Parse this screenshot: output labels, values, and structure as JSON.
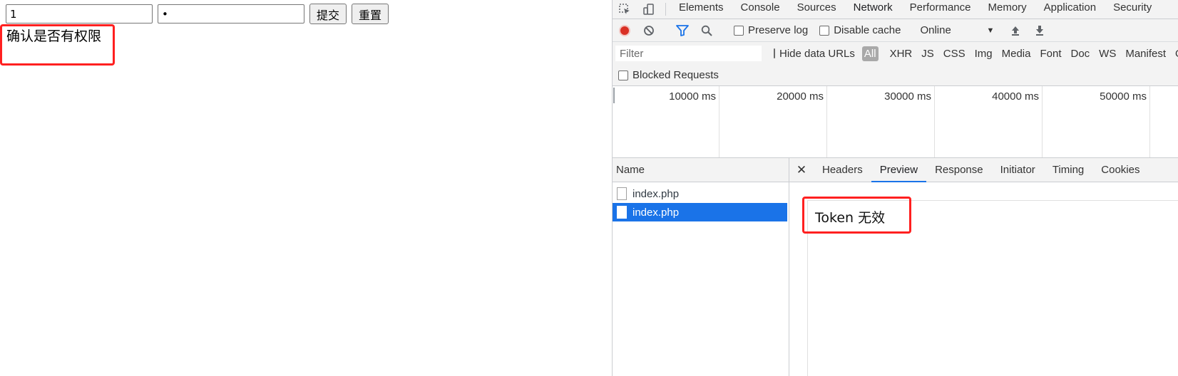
{
  "page": {
    "username_value": "1",
    "password_value": "•",
    "submit_label": "提交",
    "reset_label": "重置",
    "result_text": "确认是否有权限"
  },
  "devtools": {
    "tabs": [
      "Elements",
      "Console",
      "Sources",
      "Network",
      "Performance",
      "Memory",
      "Application",
      "Security"
    ],
    "active_tab": "Network",
    "toolbar": {
      "preserve_log": "Preserve log",
      "disable_cache": "Disable cache",
      "throttling": "Online"
    },
    "filter": {
      "placeholder": "Filter",
      "hide_data_urls": "Hide data URLs",
      "types": [
        "All",
        "XHR",
        "JS",
        "CSS",
        "Img",
        "Media",
        "Font",
        "Doc",
        "WS",
        "Manifest",
        "Ot"
      ],
      "blocked_requests": "Blocked Requests"
    },
    "timeline_ticks": [
      "10000 ms",
      "20000 ms",
      "30000 ms",
      "40000 ms",
      "50000 ms"
    ],
    "request_list": {
      "header": "Name",
      "rows": [
        "index.php",
        "index.php"
      ],
      "selected_index": 1
    },
    "detail_tabs": [
      "Headers",
      "Preview",
      "Response",
      "Initiator",
      "Timing",
      "Cookies"
    ],
    "active_detail_tab": "Preview",
    "preview_text": "Token 无效"
  },
  "colors": {
    "highlight_box": "#ff2020",
    "accent": "#1a73e8",
    "record": "#d93025"
  }
}
